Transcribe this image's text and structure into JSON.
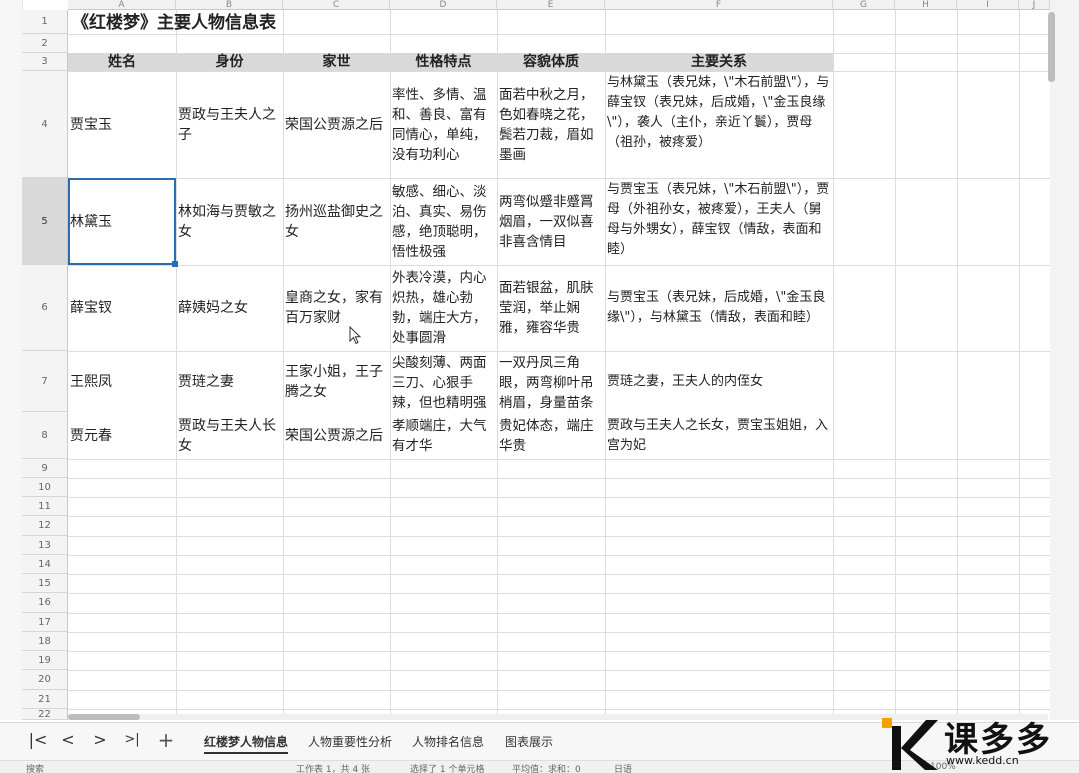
{
  "columns": [
    "A",
    "B",
    "C",
    "D",
    "E",
    "F",
    "G",
    "H",
    "I",
    "J"
  ],
  "rows": [
    "1",
    "2",
    "3",
    "4",
    "5",
    "6",
    "7",
    "8",
    "9",
    "10",
    "11",
    "12",
    "13",
    "14",
    "15",
    "16",
    "17",
    "18",
    "19",
    "20",
    "21",
    "22"
  ],
  "selected_row": "5",
  "title": "《红楼梦》主要人物信息表",
  "headers": [
    "姓名",
    "身份",
    "家世",
    "性格特点",
    "容貌体质",
    "主要关系"
  ],
  "records": [
    {
      "name": "贾宝玉",
      "identity": "贾政与王夫人之子",
      "family": "荣国公贾源之后",
      "personality": "率性、多情、温和、善良、富有同情心，单纯，没有功利心",
      "appearance": "面若中秋之月，色如春晓之花，鬓若刀裁，眉如墨画",
      "relations": "与林黛玉（表兄妹，\\\"木石前盟\\\"），与薛宝钗（表兄妹，后成婚，\\\"金玉良缘\\\"），袭人（主仆，亲近丫鬟），贾母（祖孙，被疼爱）"
    },
    {
      "name": "林黛玉",
      "identity": "林如海与贾敏之女",
      "family": "扬州巡盐御史之女",
      "personality": "敏感、细心、淡泊、真实、易伤感，绝顶聪明，悟性极强",
      "appearance": "两弯似蹙非蹙罥烟眉，一双似喜非喜含情目",
      "relations": "与贾宝玉（表兄妹，\\\"木石前盟\\\"），贾母（外祖孙女，被疼爱），王夫人（舅母与外甥女），薛宝钗（情敌，表面和睦）"
    },
    {
      "name": "薛宝钗",
      "identity": "薛姨妈之女",
      "family": "皇商之女，家有百万家财",
      "personality": "外表冷漠，内心炽热，雄心勃勃，端庄大方，处事圆滑",
      "appearance": "面若银盆，肌肤莹润，举止娴雅，雍容华贵",
      "relations": "与贾宝玉（表兄妹，后成婚，\\\"金玉良缘\\\"），与林黛玉（情敌，表面和睦）"
    },
    {
      "name": "王熙凤",
      "identity": "贾琏之妻",
      "family": "王家小姐，王子腾之女",
      "personality": "尖酸刻薄、两面三刀、心狠手辣，但也精明强干",
      "appearance": "一双丹凤三角眼，两弯柳叶吊梢眉，身量苗条",
      "relations": "贾琏之妻，王夫人的内侄女"
    },
    {
      "name": "贾元春",
      "identity": "贾政与王夫人长女",
      "family": "荣国公贾源之后",
      "personality": "孝顺端庄，大气有才华",
      "appearance": "贵妃体态，端庄华贵",
      "relations": "贾政与王夫人之长女，贾宝玉姐姐，入宫为妃"
    }
  ],
  "tabs": {
    "nav_first": "|<",
    "nav_prev": "<",
    "nav_next": ">",
    "nav_last": ">|",
    "add": "+",
    "sheets": [
      "红楼梦人物信息",
      "人物重要性分析",
      "人物排名信息",
      "图表展示"
    ],
    "active_index": 0
  },
  "status": {
    "search": "搜索",
    "sheet": "工作表 1，共 4 张",
    "selection": "选择了 1 个单元格",
    "average": "平均值：求和：0",
    "mode": "日语",
    "zoom": "100%"
  },
  "watermark": {
    "brand": "课多多",
    "url": "www.kedd.cn"
  },
  "colors": {
    "header_fill": "#d9d9d9",
    "selection": "#2b6cb0",
    "logo_orange": "#f5a000"
  }
}
